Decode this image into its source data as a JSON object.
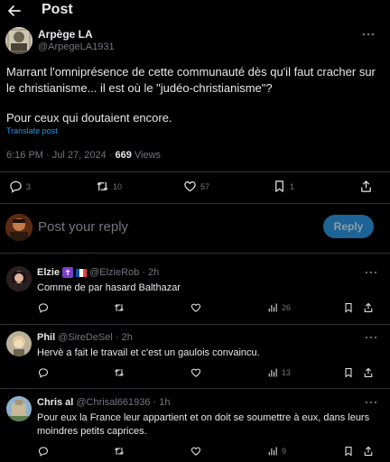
{
  "header": {
    "title": "Post"
  },
  "post": {
    "author_name": "Arpège LA",
    "author_handle": "@ArpegeLA1931",
    "text_line1": "Marrant l'omniprésence de cette communauté dès qu'il faut cracher sur le christianisme... il est où le \"judéo-christianisme\"?",
    "text_line2": "Pour ceux qui doutaient encore.",
    "translate": "Translate post",
    "time": "6:16 PM · Jul 27, 2024 · ",
    "views_count": "669",
    "views_label": " Views",
    "replies": "3",
    "reposts": "10",
    "likes": "57",
    "bookmarks": "1"
  },
  "reply_box": {
    "placeholder": "Post your reply",
    "button": "Reply"
  },
  "comments": [
    {
      "name": "Elzie",
      "handle": "@ElzieRob · 2h",
      "text": "Comme de par hasard Balthazar",
      "views": "26"
    },
    {
      "name": "Phil",
      "handle": "@SireDeSel · 2h",
      "text": "Hervè a fait le travail et c'est un gaulois convaincu.",
      "views": "13"
    },
    {
      "name": "Chris al",
      "handle": "@Chrisal661936 · 1h",
      "text": "Pour eux la France leur appartient et on doit se soumettre à eux, dans leurs moindres petits caprices.",
      "views": "9"
    }
  ],
  "icons": {
    "back": "arrow-left-icon",
    "more": "ellipsis-icon",
    "reply": "speech-bubble-icon",
    "repost": "repost-icon",
    "like": "heart-icon",
    "bookmark": "bookmark-icon",
    "share": "share-icon",
    "views": "bar-chart-icon",
    "badge": "cross-icon"
  },
  "colors": {
    "background": "#000000",
    "text": "#e7e9ea",
    "muted": "#71767b",
    "link": "#1d9bf0",
    "reply_button": "#1d6396",
    "divider": "#2f3336"
  }
}
